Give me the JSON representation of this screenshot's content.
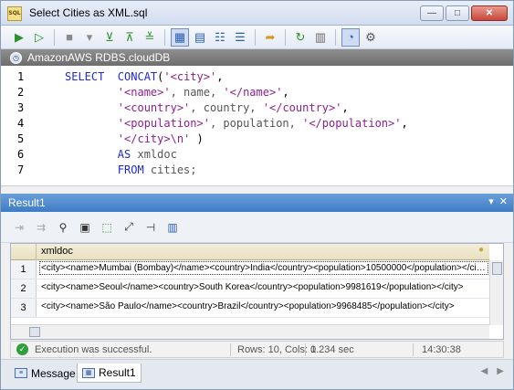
{
  "window": {
    "title": "Select Cities as XML.sql",
    "app_icon_text": "SQL",
    "minimize": "—",
    "maximize": "□",
    "close": "✕"
  },
  "toolbar": {
    "icons": [
      "execute-icon",
      "execute-step-icon",
      "stop-icon",
      "grid-icon",
      "text-icon",
      "table-icon",
      "transaction-icon",
      "refresh-icon",
      "export-icon",
      "history-icon",
      "timer-icon",
      "hierarchy-icon"
    ]
  },
  "connection": {
    "label": "AmazonAWS RDBS.cloudDB"
  },
  "editor": {
    "lines": [
      {
        "num": "1",
        "parts": [
          {
            "t": "SELECT  ",
            "c": "kw"
          },
          {
            "t": "CONCAT",
            "c": "kw"
          },
          {
            "t": "(",
            "c": "pun"
          },
          {
            "t": "'<city>'",
            "c": "str"
          },
          {
            "t": ",",
            "c": "pun"
          }
        ]
      },
      {
        "num": "2",
        "parts": [
          {
            "t": "        ",
            "c": "pun"
          },
          {
            "t": "'<name>'",
            "c": "str"
          },
          {
            "t": ", name, ",
            "c": "id"
          },
          {
            "t": "'</name>'",
            "c": "str"
          },
          {
            "t": ",",
            "c": "pun"
          }
        ]
      },
      {
        "num": "3",
        "parts": [
          {
            "t": "        ",
            "c": "pun"
          },
          {
            "t": "'<country>'",
            "c": "str"
          },
          {
            "t": ", country, ",
            "c": "id"
          },
          {
            "t": "'</country>'",
            "c": "str"
          },
          {
            "t": ",",
            "c": "pun"
          }
        ]
      },
      {
        "num": "4",
        "parts": [
          {
            "t": "        ",
            "c": "pun"
          },
          {
            "t": "'<population>'",
            "c": "str"
          },
          {
            "t": ", population, ",
            "c": "id"
          },
          {
            "t": "'</population>'",
            "c": "str"
          },
          {
            "t": ",",
            "c": "pun"
          }
        ]
      },
      {
        "num": "5",
        "parts": [
          {
            "t": "        ",
            "c": "pun"
          },
          {
            "t": "'</city>\\n'",
            "c": "str"
          },
          {
            "t": " )",
            "c": "pun"
          }
        ]
      },
      {
        "num": "6",
        "parts": [
          {
            "t": "        ",
            "c": "pun"
          },
          {
            "t": "AS",
            "c": "kw"
          },
          {
            "t": " xmldoc",
            "c": "id"
          }
        ]
      },
      {
        "num": "7",
        "parts": [
          {
            "t": "        ",
            "c": "pun"
          },
          {
            "t": "FROM",
            "c": "kw"
          },
          {
            "t": " cities;",
            "c": "id"
          }
        ]
      }
    ]
  },
  "result_panel": {
    "title": "Result1",
    "pin": "▾",
    "close": "✕"
  },
  "grid": {
    "column": "xmldoc",
    "rows": [
      {
        "num": "1",
        "value": "<city><name>Mumbai (Bombay)</name><country>India</country><population>10500000</population></city>"
      },
      {
        "num": "2",
        "value": "<city><name>Seoul</name><country>South Korea</country><population>9981619</population></city>"
      },
      {
        "num": "3",
        "value": "<city><name>São Paulo</name><country>Brazil</country><population>9968485</population></city>"
      }
    ]
  },
  "status": {
    "message": "Execution was successful.",
    "rows_cols": "Rows: 10, Cols: 1",
    "time": "0.234 sec",
    "clock": "14:30:38"
  },
  "tabs": [
    {
      "label": "Message"
    },
    {
      "label": "Result1"
    }
  ]
}
